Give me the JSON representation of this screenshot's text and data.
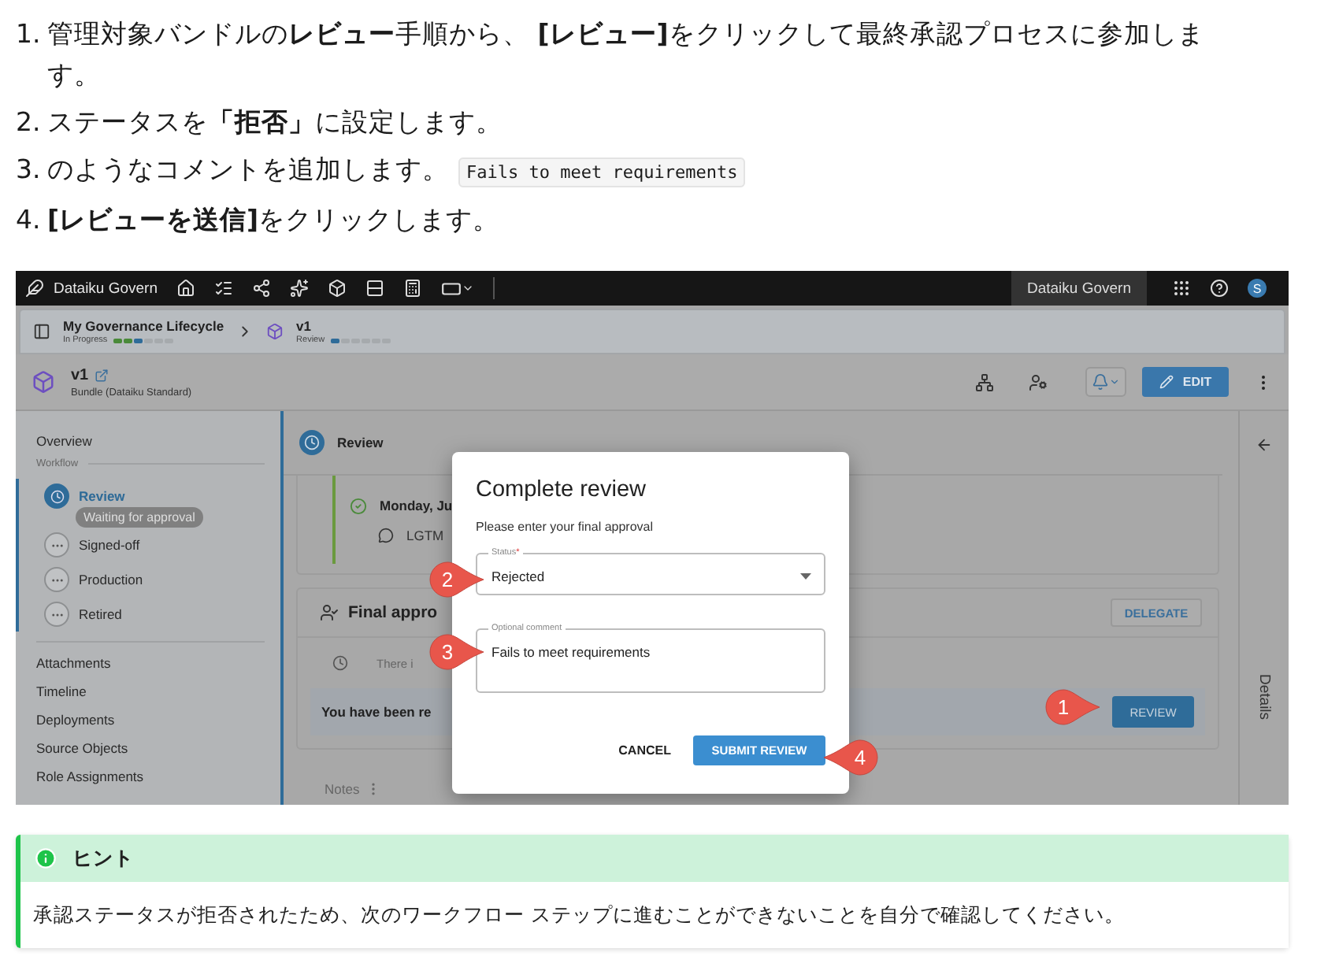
{
  "steps": [
    {
      "number": "1.",
      "text": "管理対象バンドルの**レビュー**手順から、 **[レビュー]**をクリックして最終承認プロセスに参加します。"
    },
    {
      "number": "2.",
      "text": "ステータスを**「拒否」**に設定します。"
    },
    {
      "number": "3.",
      "text": "のようなコメントを追加します。",
      "code": "Fails to meet requirements"
    },
    {
      "number": "4.",
      "text": "**[レビューを送信]**をクリックします。"
    }
  ],
  "app": {
    "topbar": {
      "brand": "Dataiku Govern",
      "workspace": "Dataiku Govern",
      "avatar": "S"
    },
    "breadcrumb": [
      {
        "title": "My Governance Lifecycle",
        "status": "In Progress",
        "level": 0.5
      },
      {
        "title": "v1",
        "status": "Review",
        "level": 0.17
      }
    ],
    "header": {
      "title": "v1",
      "subtitle": "Bundle (Dataiku Standard)",
      "edit": "EDIT"
    },
    "sidebar": {
      "overview": "Overview",
      "workflow_label": "Workflow",
      "steps": [
        {
          "label": "Review",
          "selected": true,
          "badge": "Waiting for approval"
        },
        {
          "label": "Signed-off",
          "selected": false
        },
        {
          "label": "Production",
          "selected": false
        },
        {
          "label": "Retired",
          "selected": false
        }
      ],
      "links": [
        "Attachments",
        "Timeline",
        "Deployments",
        "Source Objects",
        "Role Assignments"
      ]
    },
    "main": {
      "section": "Review",
      "event": {
        "date": "Monday, Ju",
        "comment": "LGTM"
      },
      "approval": {
        "title": "Final appro",
        "delegate": "DELEGATE",
        "pending": "There i",
        "notice": "You have been re",
        "review": "REVIEW"
      },
      "notes": "Notes"
    },
    "details": "Details",
    "modal": {
      "title": "Complete review",
      "prompt": "Please enter your final approval",
      "status": {
        "label": "Status",
        "required_mark": "*",
        "value": "Rejected"
      },
      "comment": {
        "label": "Optional comment",
        "value": "Fails to meet requirements"
      },
      "cancel": "CANCEL",
      "submit": "SUBMIT REVIEW"
    },
    "callouts": [
      "1",
      "2",
      "3",
      "4"
    ]
  },
  "hint": {
    "title": "ヒント",
    "text": "承認ステータスが拒否されたため、次のワークフロー ステップに進むことができないことを自分で確認してください。"
  }
}
